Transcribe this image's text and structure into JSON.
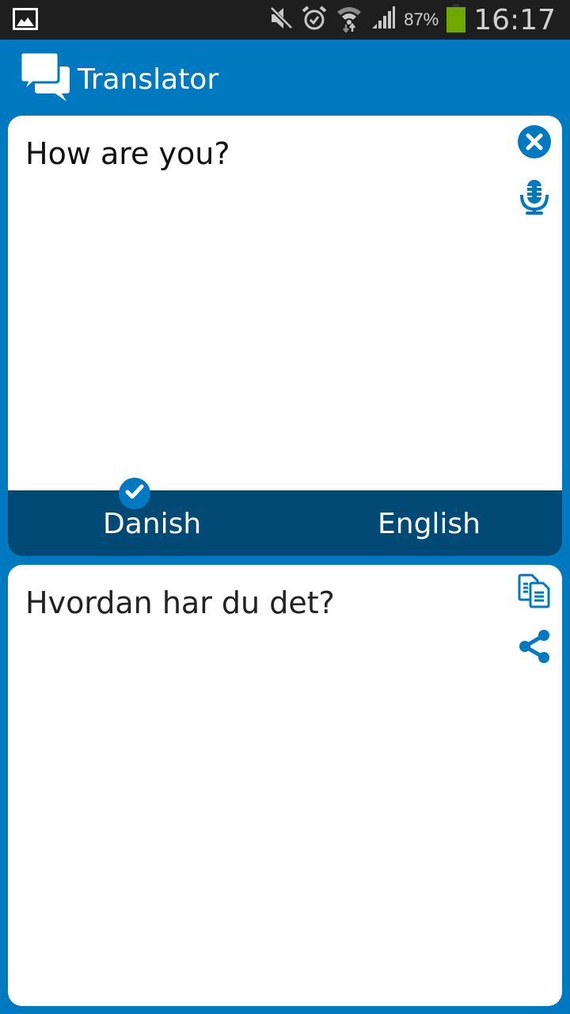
{
  "status_bar": {
    "notification_icon": "image-icon",
    "icons": [
      "mute-icon",
      "alarm-icon",
      "wifi-icon",
      "signal-icon"
    ],
    "battery_percent": "87%",
    "battery_level": 0.87,
    "battery_color": "#6fa800",
    "time": "16:17"
  },
  "app_bar": {
    "logo_icon": "chat-bubbles-icon",
    "title": "Translator",
    "background": "#0079c1"
  },
  "source_panel": {
    "text": "How are you?",
    "clear_icon": "close-circle-icon",
    "mic_icon": "microphone-icon"
  },
  "language_bar": {
    "source_language": "Danish",
    "target_language": "English",
    "selected": "Danish",
    "selected_icon": "check-icon",
    "background": "#004a75"
  },
  "result_panel": {
    "text": "Hvordan har du det?",
    "copy_icon": "copy-icon",
    "share_icon": "share-icon"
  }
}
